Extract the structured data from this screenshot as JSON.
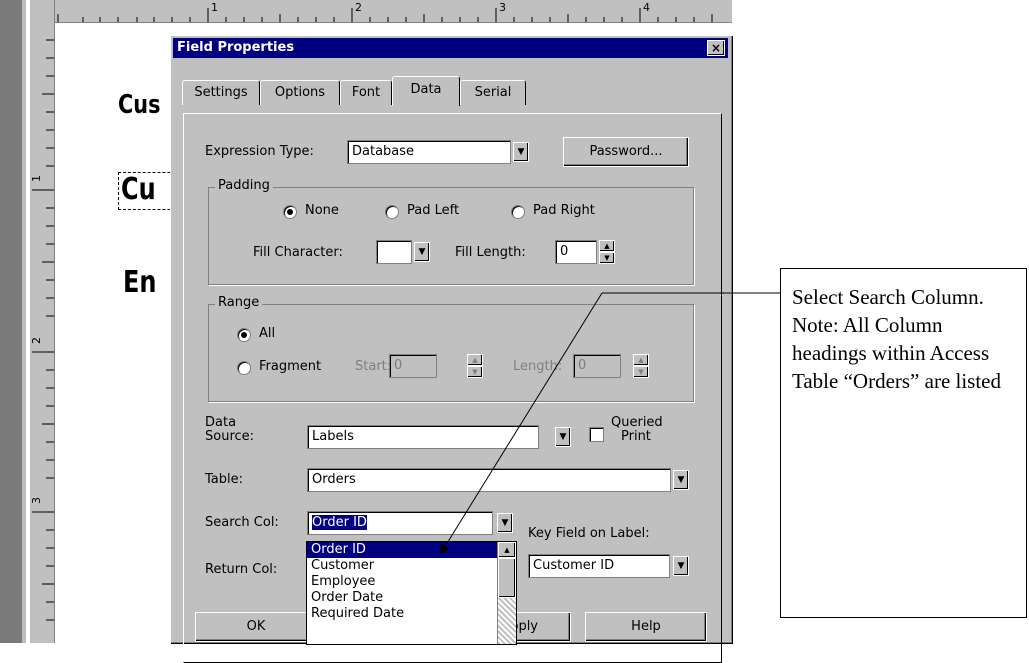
{
  "ruler": {
    "unit": "in",
    "marks": [
      "1",
      "2",
      "3",
      "4"
    ],
    "vmarks": [
      "1",
      "2",
      "3"
    ]
  },
  "canvas": {
    "text1": "Cus",
    "text2": "Cu",
    "text3": "En"
  },
  "dialog": {
    "title": "Field Properties",
    "close_label": "×",
    "tabs": [
      {
        "label": "Settings"
      },
      {
        "label": "Options"
      },
      {
        "label": "Font"
      },
      {
        "label": "Data",
        "active": true
      },
      {
        "label": "Serial"
      }
    ],
    "expression_type": {
      "label": "Expression Type:",
      "value": "Database"
    },
    "password_button": "Password...",
    "padding": {
      "title": "Padding",
      "options": [
        "None",
        "Pad Left",
        "Pad Right"
      ],
      "selected": "None",
      "fill_character_label": "Fill Character:",
      "fill_character_value": "",
      "fill_length_label": "Fill Length:",
      "fill_length_value": "0"
    },
    "range": {
      "title": "Range",
      "options": [
        "All",
        "Fragment"
      ],
      "selected": "All",
      "start_label": "Start:",
      "start_value": "0",
      "length_label": "Length:",
      "length_value": "0"
    },
    "data_source": {
      "label_line1": "Data",
      "label_line2": "Source:",
      "value": "Labels"
    },
    "queried_print": {
      "label_line1": "Queried",
      "label_line2": "Print",
      "checked": false
    },
    "table": {
      "label": "Table:",
      "value": "Orders"
    },
    "search_col": {
      "label": "Search Col:",
      "value": "Order ID"
    },
    "return_col": {
      "label": "Return Col:"
    },
    "key_field": {
      "label": "Key Field on Label:",
      "value": "Customer ID"
    },
    "dropdown_options": [
      "Order ID",
      "Customer",
      "Employee",
      "Order Date",
      "Required Date"
    ],
    "dropdown_selected": "Order ID",
    "buttons": {
      "ok": "OK",
      "apply": "Apply",
      "help": "Help"
    }
  },
  "callout": {
    "text": "Select Search Column. Note: All Column headings within Access Table “Orders” are listed"
  }
}
